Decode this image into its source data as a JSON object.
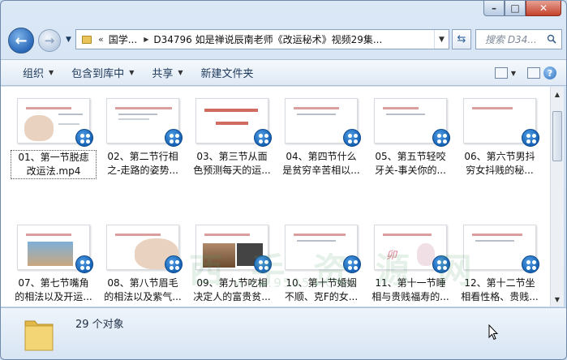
{
  "window": {
    "caption": {
      "minimize": "–",
      "maximize": "□",
      "close": "✕"
    }
  },
  "nav": {
    "back_icon": "back-arrow-icon",
    "forward_icon": "forward-arrow-icon",
    "address": {
      "chevron": "«",
      "segments": [
        "国学...",
        "D34796 如是禅说辰南老师《改运秘术》视频29集..."
      ],
      "dropdown": "▼"
    },
    "refresh": "⇆",
    "search_placeholder": "搜索 D34..."
  },
  "toolbar": {
    "items": [
      {
        "label": "组织",
        "has_menu": true
      },
      {
        "label": "包含到库中",
        "has_menu": true
      },
      {
        "label": "共享",
        "has_menu": true
      },
      {
        "label": "新建文件夹",
        "has_menu": false
      }
    ],
    "help": "?"
  },
  "files": [
    {
      "label": "01、第一节脱痣\n改运法.mp4"
    },
    {
      "label": "02、第二节行相\n之-走路的姿势..."
    },
    {
      "label": "03、第三节从面\n色预测每天的运..."
    },
    {
      "label": "04、第四节什么\n是贫穷辛苦相以..."
    },
    {
      "label": "05、第五节轻咬\n牙关-事关你的..."
    },
    {
      "label": "06、第六节男抖\n穷女抖贱的秘..."
    },
    {
      "label": "07、第七节嘴角\n的相法以及开运..."
    },
    {
      "label": "08、第八节眉毛\n的相法以及紫气..."
    },
    {
      "label": "09、第九节吃相\n决定人的富贵贫..."
    },
    {
      "label": "10、第十节婚姻\n不顺、克F的女..."
    },
    {
      "label": "11、第十一节睡\n相与贵贱福寿的..."
    },
    {
      "label": "12、第十二节坐\n相看性格、贵贱..."
    }
  ],
  "watermark": {
    "main": "西 手 资 源 网",
    "sub": "www.95959.com"
  },
  "status": {
    "count": "29 个对象"
  },
  "colors": {
    "accent": "#2a68b8",
    "badge": "#1561b4",
    "details_bg": "#e3edf8"
  }
}
